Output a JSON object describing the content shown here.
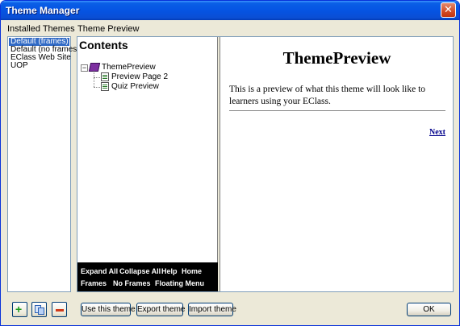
{
  "window": {
    "title": "Theme Manager",
    "close_symbol": "✕"
  },
  "labels": {
    "installed_themes": "Installed Themes",
    "theme_preview": "Theme Preview"
  },
  "themes": [
    {
      "label": "Default (frames)",
      "selected": true
    },
    {
      "label": "Default (no frames)",
      "selected": false
    },
    {
      "label": "EClass Web Site",
      "selected": false
    },
    {
      "label": "UOP",
      "selected": false
    }
  ],
  "preview": {
    "toc_heading": "Contents",
    "tree": {
      "root": "ThemePreview",
      "expander": "−",
      "children": [
        "Preview Page 2",
        "Quiz Preview"
      ]
    },
    "nav": {
      "row1": [
        "Expand All",
        "Collapse All",
        "Help",
        "Home"
      ],
      "row2": [
        "Frames",
        "No Frames",
        "Floating Menu"
      ]
    },
    "content": {
      "title": "ThemePreview",
      "text": "This is a preview of what this theme will look like to learners using your EClass.",
      "next_link": "Next"
    }
  },
  "buttons": {
    "use_theme": "Use this theme",
    "export_theme": "Export theme",
    "import_theme": "Import theme",
    "ok": "OK"
  },
  "icons": {
    "add": "plus-icon",
    "copy": "copy-icon",
    "remove": "minus-icon"
  }
}
